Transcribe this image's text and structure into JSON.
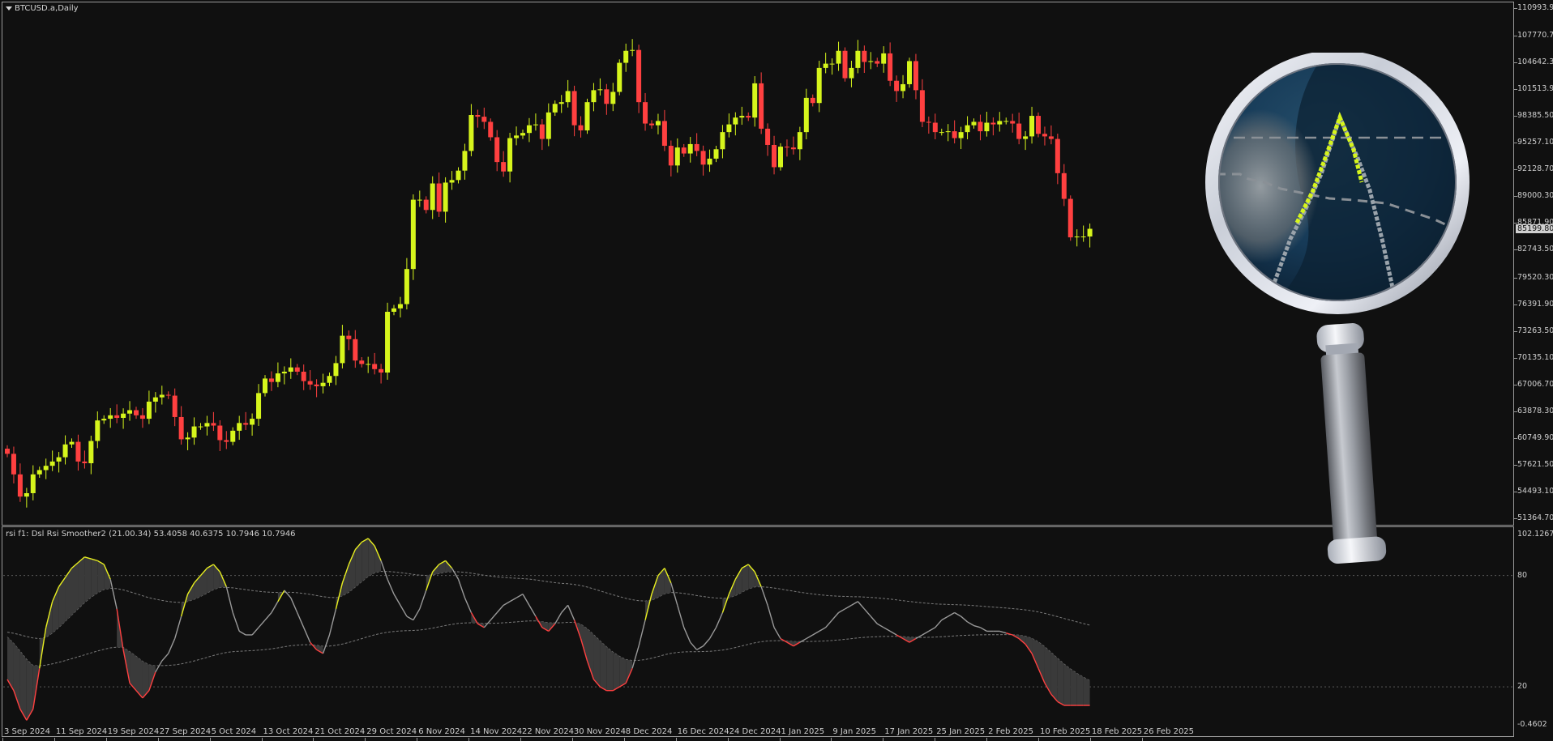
{
  "chart_data": [
    {
      "type": "candlestick",
      "title": "BTCUSD.a,Daily",
      "colors": {
        "up": "#d6f51c",
        "down": "#ff4040",
        "background": "#101010"
      },
      "y_axis_labels": [
        "110993.90",
        "107770.70",
        "104642.30",
        "101513.90",
        "98385.50",
        "95257.10",
        "92128.70",
        "89000.30",
        "85871.90",
        "82743.50",
        "79520.30",
        "76391.90",
        "73263.50",
        "70135.10",
        "67006.70",
        "63878.30",
        "60749.90",
        "57621.50",
        "54493.10",
        "51364.70"
      ],
      "ylim": [
        51364.7,
        110993.9
      ],
      "current_price": "85199.80",
      "x_axis_labels": [
        "3 Sep 2024",
        "11 Sep 2024",
        "19 Sep 2024",
        "27 Sep 2024",
        "5 Oct 2024",
        "13 Oct 2024",
        "21 Oct 2024",
        "29 Oct 2024",
        "6 Nov 2024",
        "14 Nov 2024",
        "22 Nov 2024",
        "30 Nov 2024",
        "8 Dec 2024",
        "16 Dec 2024",
        "24 Dec 2024",
        "1 Jan 2025",
        "9 Jan 2025",
        "17 Jan 2025",
        "25 Jan 2025",
        "2 Feb 2025",
        "10 Feb 2025",
        "18 Feb 2025",
        "26 Feb 2025"
      ],
      "close": [
        58900,
        56500,
        53900,
        54300,
        56500,
        57000,
        57500,
        58000,
        58500,
        60000,
        60300,
        58000,
        57800,
        60400,
        62800,
        63000,
        63400,
        63100,
        63600,
        64000,
        63400,
        63000,
        65000,
        65500,
        65800,
        65700,
        63200,
        60600,
        60800,
        62100,
        62100,
        62500,
        62200,
        60500,
        60300,
        61600,
        62500,
        62300,
        63000,
        66000,
        67700,
        67300,
        68300,
        68500,
        69000,
        68500,
        67400,
        67000,
        66800,
        67200,
        68000,
        69500,
        72700,
        72300,
        69800,
        69400,
        69400,
        68800,
        68400,
        75500,
        75900,
        76400,
        80500,
        88600,
        88600,
        87400,
        90500,
        87200,
        90600,
        90900,
        92000,
        94300,
        98500,
        98300,
        97700,
        95900,
        93000,
        91900,
        95800,
        96100,
        96400,
        97300,
        97400,
        95700,
        98800,
        99800,
        100000,
        101300,
        97300,
        96700,
        100000,
        101400,
        101500,
        99800,
        101200,
        104600,
        106000,
        106100,
        100000,
        97500,
        97300,
        97800,
        94900,
        92600,
        94700,
        94000,
        95100,
        94300,
        92700,
        93400,
        94500,
        96500,
        97400,
        98200,
        98400,
        98200,
        102200,
        96900,
        95000,
        92400,
        94800,
        94700,
        94500,
        96500,
        100500,
        99900,
        104000,
        104500,
        104500,
        106000,
        102800,
        104000,
        106000,
        104700,
        104800,
        104500,
        105700,
        102500,
        101300,
        102100,
        104800,
        101400,
        97700,
        97600,
        96500,
        96500,
        96600,
        95800,
        96500,
        97300,
        97700,
        96600,
        97600,
        97400,
        97800,
        97800,
        97500,
        95700,
        96000,
        98400,
        96300,
        96000,
        95700,
        91700,
        88700,
        84200,
        84300,
        84300,
        85200
      ]
    },
    {
      "type": "line",
      "title": "rsi f1: Dsl Rsi Smoother2 (21.00.34) 53.4058 40.6375 10.7946 10.7946",
      "y_axis_labels": [
        "102.1267",
        "80",
        "20",
        "-0.4602"
      ],
      "ylim": [
        -0.4602,
        102.1267
      ],
      "levels": [
        80,
        20
      ],
      "colors": {
        "rising": "#e9f020",
        "falling": "#ff4040",
        "neutral": "#9a9a9a",
        "fill": "#3a3a3a"
      },
      "note_points": "values per bar (see main series indices)",
      "rsi": [
        24,
        18,
        8,
        2,
        8,
        30,
        52,
        66,
        74,
        79,
        84,
        87,
        90,
        89,
        88,
        86,
        78,
        62,
        40,
        22,
        18,
        14,
        18,
        28,
        34,
        38,
        46,
        58,
        70,
        76,
        80,
        84,
        86,
        82,
        74,
        60,
        50,
        48,
        48,
        52,
        56,
        60,
        66,
        72,
        68,
        60,
        52,
        44,
        40,
        38,
        48,
        62,
        76,
        86,
        94,
        98,
        100,
        96,
        88,
        78,
        70,
        64,
        58,
        56,
        62,
        72,
        82,
        86,
        88,
        84,
        78,
        68,
        60,
        54,
        52,
        56,
        60,
        64,
        66,
        68,
        70,
        64,
        58,
        52,
        50,
        54,
        60,
        64,
        56,
        46,
        34,
        24,
        20,
        18,
        18,
        20,
        22,
        30,
        42,
        56,
        70,
        80,
        84,
        76,
        64,
        52,
        44,
        40,
        42,
        46,
        52,
        60,
        70,
        78,
        84,
        86,
        82,
        74,
        64,
        52,
        46,
        44,
        42,
        44,
        46,
        48,
        50,
        52,
        56,
        60,
        62,
        64,
        66,
        62,
        58,
        54,
        52,
        50,
        48,
        46,
        44,
        46,
        48,
        50,
        52,
        56,
        58,
        60,
        58,
        55,
        53,
        52,
        50,
        50,
        50,
        49,
        48,
        46,
        43,
        38,
        30,
        22,
        16,
        12,
        10,
        10,
        10,
        10,
        10,
        10,
        10,
        10,
        10,
        10,
        10,
        10,
        10,
        10,
        11
      ]
    }
  ]
}
